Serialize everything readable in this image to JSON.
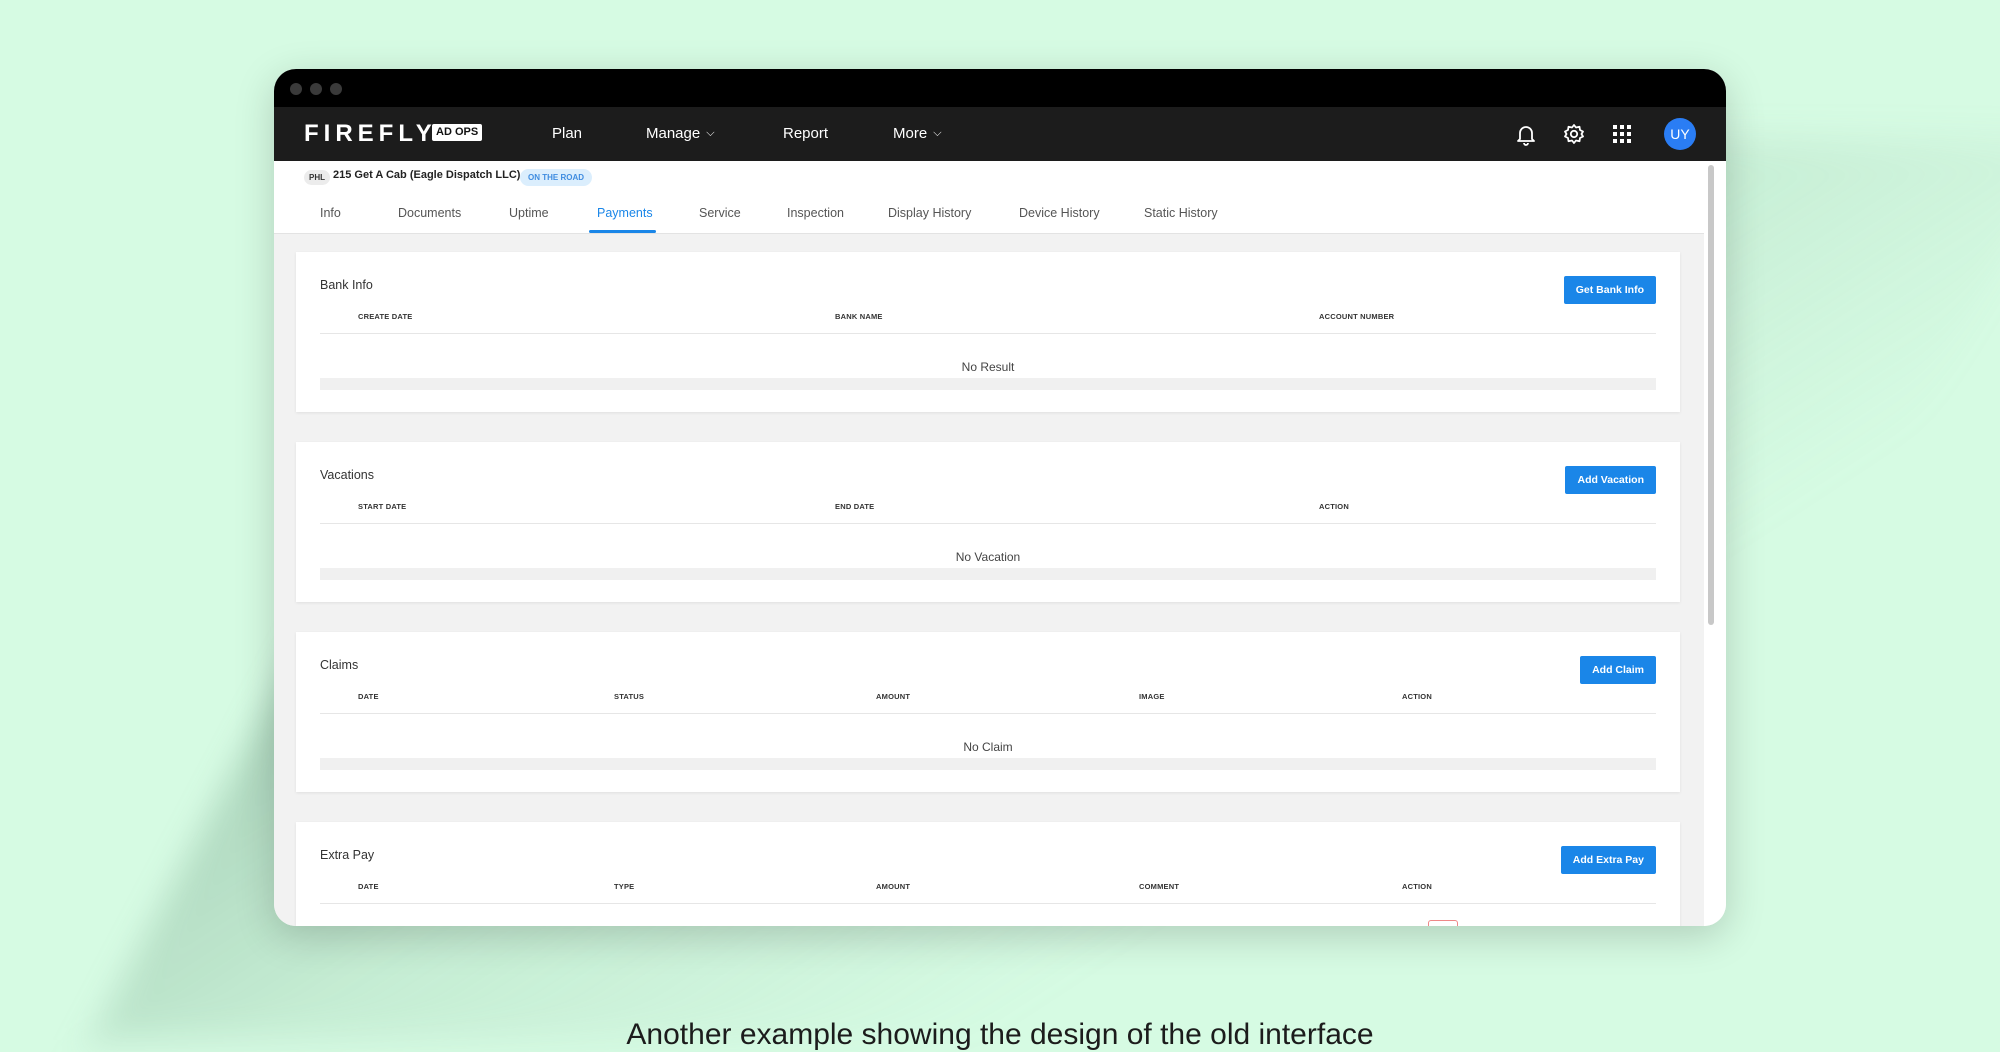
{
  "app": {
    "logo": "FIREFLY",
    "logo_badge": "AD OPS",
    "nav": [
      {
        "label": "Plan",
        "dropdown": false
      },
      {
        "label": "Manage",
        "dropdown": true
      },
      {
        "label": "Report",
        "dropdown": false
      },
      {
        "label": "More",
        "dropdown": true
      }
    ],
    "user_initials": "UY",
    "icons": [
      "bell-icon",
      "gear-icon",
      "apps-grid-icon"
    ],
    "colors": {
      "accent": "#1a86e8",
      "nav_bg": "#1c1c1c",
      "avatar": "#2a7df4",
      "page_bg": "#d6fbe3"
    }
  },
  "vehicle": {
    "market": "PHL",
    "name": "215 Get A Cab (Eagle Dispatch LLC)",
    "status": "ON THE ROAD"
  },
  "tabs": [
    {
      "label": "Info"
    },
    {
      "label": "Documents"
    },
    {
      "label": "Uptime"
    },
    {
      "label": "Payments",
      "active": true
    },
    {
      "label": "Service"
    },
    {
      "label": "Inspection"
    },
    {
      "label": "Display History"
    },
    {
      "label": "Device History"
    },
    {
      "label": "Static History"
    }
  ],
  "sections": {
    "bank": {
      "title": "Bank Info",
      "button": "Get Bank Info",
      "columns": [
        "CREATE DATE",
        "BANK NAME",
        "ACCOUNT NUMBER"
      ],
      "empty": "No Result"
    },
    "vacations": {
      "title": "Vacations",
      "button": "Add Vacation",
      "columns": [
        "START DATE",
        "END DATE",
        "ACTION"
      ],
      "empty": "No Vacation"
    },
    "claims": {
      "title": "Claims",
      "button": "Add Claim",
      "columns": [
        "DATE",
        "STATUS",
        "AMOUNT",
        "IMAGE",
        "ACTION"
      ],
      "empty": "No Claim"
    },
    "extra_pay": {
      "title": "Extra Pay",
      "button": "Add Extra Pay",
      "columns": [
        "DATE",
        "TYPE",
        "AMOUNT",
        "COMMENT",
        "ACTION"
      ]
    }
  },
  "caption": "Another example showing the design of the old interface"
}
